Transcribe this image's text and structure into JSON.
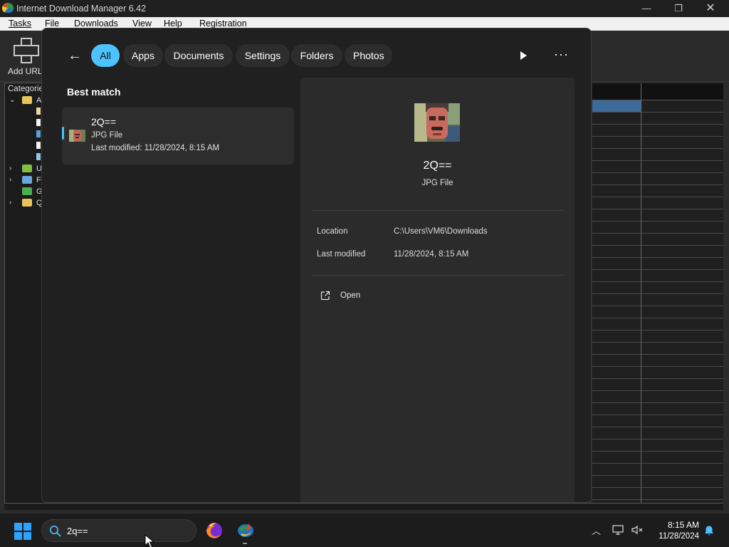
{
  "idm_window": {
    "title": "Internet Download Manager 6.42",
    "menu": [
      "Tasks",
      "File",
      "Downloads",
      "View",
      "Help",
      "Registration"
    ],
    "toolbar_add_url": "Add URL",
    "categories_header": "Categorie",
    "tree": [
      {
        "chevron": "⌄",
        "label": "A",
        "icon_color": "#e8c55a"
      },
      {
        "chevron": "›",
        "label": "U",
        "icon_color": "#7fbf3f"
      },
      {
        "chevron": "›",
        "label": "Fi",
        "icon_color": "#6aa6e0"
      },
      {
        "chevron": "",
        "label": "G",
        "icon_color": "#4caf50"
      },
      {
        "chevron": "›",
        "label": "Q",
        "icon_color": "#e8c55a"
      }
    ],
    "window_controls": {
      "minimize": "—",
      "maximize": "❐",
      "close": "✕"
    }
  },
  "search_panel": {
    "filters": [
      {
        "label": "All",
        "active": true
      },
      {
        "label": "Apps",
        "active": false
      },
      {
        "label": "Documents",
        "active": false
      },
      {
        "label": "Settings",
        "active": false
      },
      {
        "label": "Folders",
        "active": false
      },
      {
        "label": "Photos",
        "active": false
      }
    ],
    "more_label": "···",
    "best_match_label": "Best match",
    "result": {
      "name": "2Q==",
      "type": "JPG File",
      "modified": "Last modified: 11/28/2024, 8:15 AM"
    },
    "detail": {
      "name": "2Q==",
      "type": "JPG File",
      "properties": [
        {
          "key": "Location",
          "value": "C:\\Users\\VM6\\Downloads"
        },
        {
          "key": "Last modified",
          "value": "11/28/2024, 8:15 AM"
        }
      ],
      "open_label": "Open"
    }
  },
  "taskbar": {
    "search_value": "2q==",
    "clock_time": "8:15 AM",
    "clock_date": "11/28/2024",
    "accent_color": "#4cc2ff"
  }
}
